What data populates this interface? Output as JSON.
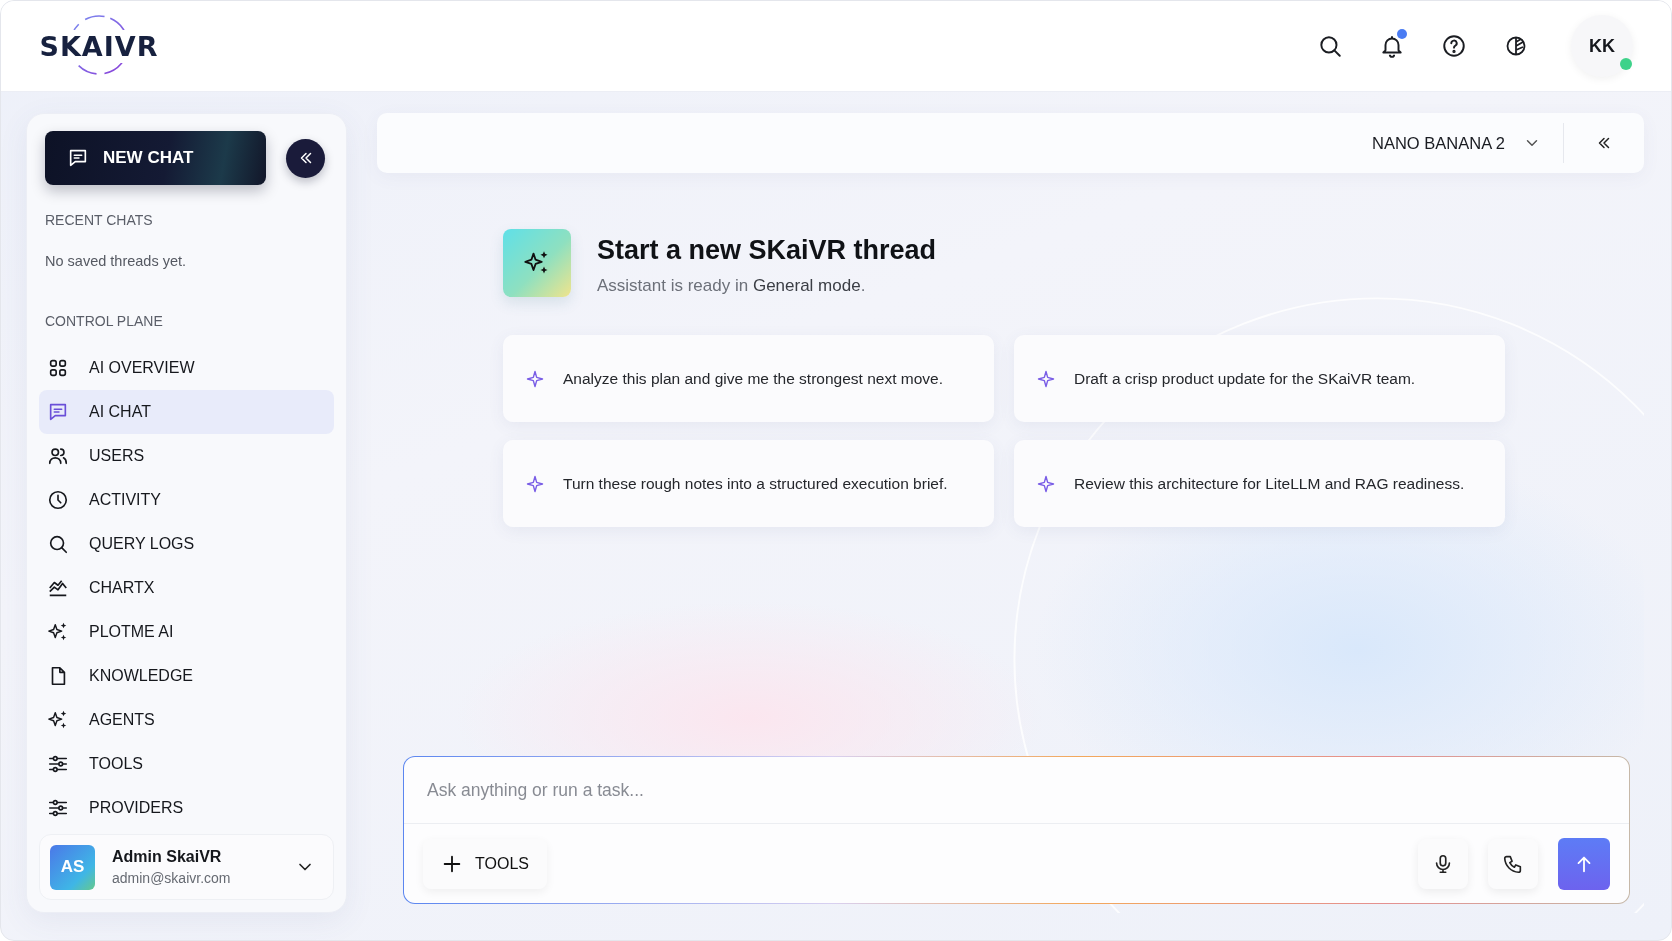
{
  "header": {
    "logo": "SKAIVR",
    "notifications_unread": true,
    "avatar": {
      "initials": "KK",
      "online": true
    }
  },
  "sidebar": {
    "new_chat": "NEW CHAT",
    "recent_label": "RECENT CHATS",
    "recent_empty": "No saved threads yet.",
    "section_label": "CONTROL PLANE",
    "items": [
      {
        "label": "AI OVERVIEW",
        "selected": false
      },
      {
        "label": "AI CHAT",
        "selected": true
      },
      {
        "label": "USERS",
        "selected": false
      },
      {
        "label": "ACTIVITY",
        "selected": false
      },
      {
        "label": "QUERY LOGS",
        "selected": false
      },
      {
        "label": "CHARTX",
        "selected": false
      },
      {
        "label": "PLOTME AI",
        "selected": false
      },
      {
        "label": "KNOWLEDGE",
        "selected": false
      },
      {
        "label": "AGENTS",
        "selected": false
      },
      {
        "label": "TOOLS",
        "selected": false
      },
      {
        "label": "PROVIDERS",
        "selected": false
      }
    ],
    "user": {
      "initials": "AS",
      "name": "Admin SkaiVR",
      "email": "admin@skaivr.com"
    }
  },
  "main": {
    "model": "NANO BANANA 2",
    "title": "Start a new SKaiVR thread",
    "subtitle": "Assistant is ready in **General mode**.",
    "prompts": [
      "Analyze this plan and give me the strongest next move.",
      "Draft a crisp product update for the SKaiVR team.",
      "Turn these rough notes into a structured execution brief.",
      "Review this architecture for LiteLLM and RAG readiness."
    ],
    "composer": {
      "placeholder": "Ask anything or run a task...",
      "tools": "TOOLS"
    }
  }
}
